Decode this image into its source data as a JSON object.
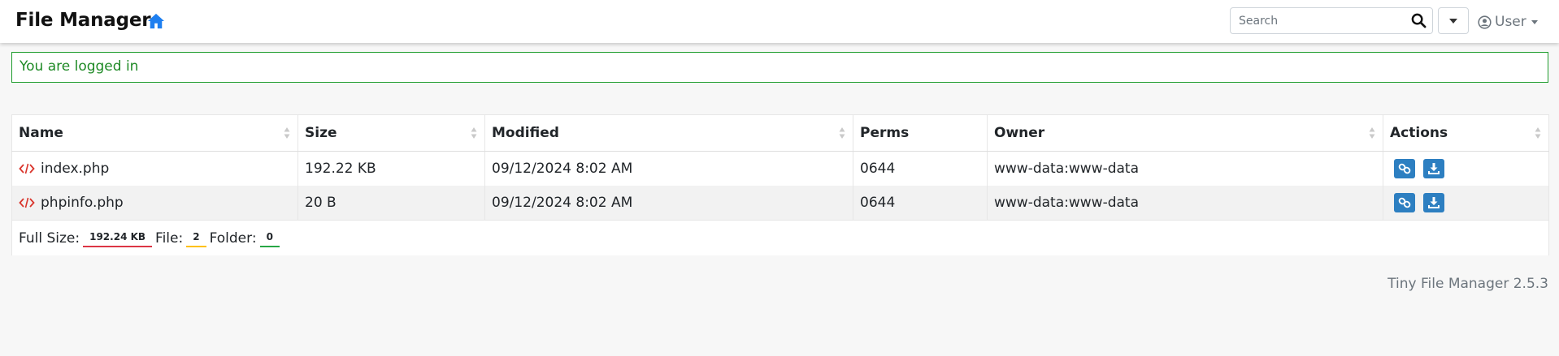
{
  "header": {
    "brand": "File Manager",
    "search_placeholder": "Search",
    "user_label": "User"
  },
  "alert": {
    "message": "You are logged in"
  },
  "table": {
    "columns": [
      "Name",
      "Size",
      "Modified",
      "Perms",
      "Owner",
      "Actions"
    ],
    "rows": [
      {
        "name": "index.php",
        "size": "192.22 KB",
        "modified": "09/12/2024 8:02 AM",
        "perms": "0644",
        "owner": "www-data:www-data"
      },
      {
        "name": "phpinfo.php",
        "size": "20 B",
        "modified": "09/12/2024 8:02 AM",
        "perms": "0644",
        "owner": "www-data:www-data"
      }
    ]
  },
  "summary": {
    "full_size_label": "Full Size:",
    "full_size_value": "192.24 KB",
    "file_label": "File:",
    "file_value": "2",
    "folder_label": "Folder:",
    "folder_value": "0"
  },
  "footer": {
    "version": "Tiny File Manager 2.5.3"
  },
  "colors": {
    "accent": "#1e7ff0",
    "alert_green": "#1f9d2e",
    "file_icon_red": "#d9342b",
    "action_blue": "#2d7fc1"
  },
  "icons": {
    "home": "home-icon",
    "search": "search-icon",
    "user": "user-circle-icon",
    "file": "code-icon",
    "link": "link-icon",
    "download": "download-icon",
    "sort": "sort-icon"
  }
}
